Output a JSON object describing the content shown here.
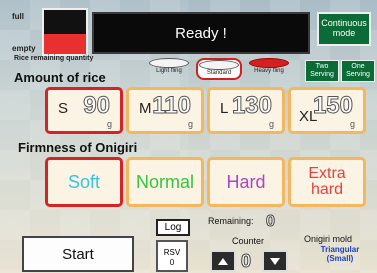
{
  "gauge": {
    "full_label": "full",
    "empty_label": "empty",
    "caption": "Rice remaining quantity",
    "fill_fraction": 0.45
  },
  "status": {
    "text": "Ready !"
  },
  "continuous_button": {
    "label": "Continuous mode"
  },
  "amount": {
    "heading": "Amount of rice",
    "cups": [
      {
        "label": "Light fling",
        "selected": false
      },
      {
        "label": "Standard",
        "selected": true
      },
      {
        "label": "Heavy fling",
        "selected": false
      }
    ],
    "serving_buttons": [
      {
        "label": "Two Serving"
      },
      {
        "label": "One Serving"
      }
    ],
    "sizes": [
      {
        "code": "S",
        "value": "90",
        "unit": "g",
        "selected": true
      },
      {
        "code": "M",
        "value": "110",
        "unit": "g",
        "selected": false
      },
      {
        "code": "L",
        "value": "130",
        "unit": "g",
        "selected": false
      },
      {
        "code": "XL",
        "value": "150",
        "unit": "g",
        "selected": false
      }
    ]
  },
  "firmness": {
    "heading": "Firmness of Onigiri",
    "options": [
      {
        "label": "Soft",
        "color": "#35c2e6",
        "selected": true
      },
      {
        "label": "Normal",
        "color": "#36c440",
        "selected": false
      },
      {
        "label": "Hard",
        "color": "#b042c4",
        "selected": false
      },
      {
        "label": "Extra hard",
        "color": "#e64040",
        "selected": false
      }
    ]
  },
  "bottom": {
    "start_label": "Start",
    "log_label": "Log",
    "remaining_label": "Remaining:",
    "remaining_value": "0",
    "counter_label": "Counter",
    "counter_value": "0",
    "rsv_label": "RSV",
    "rsv_value": "0",
    "mold_label": "Onigiri mold",
    "mold_value": "Triangular (Small)"
  }
}
